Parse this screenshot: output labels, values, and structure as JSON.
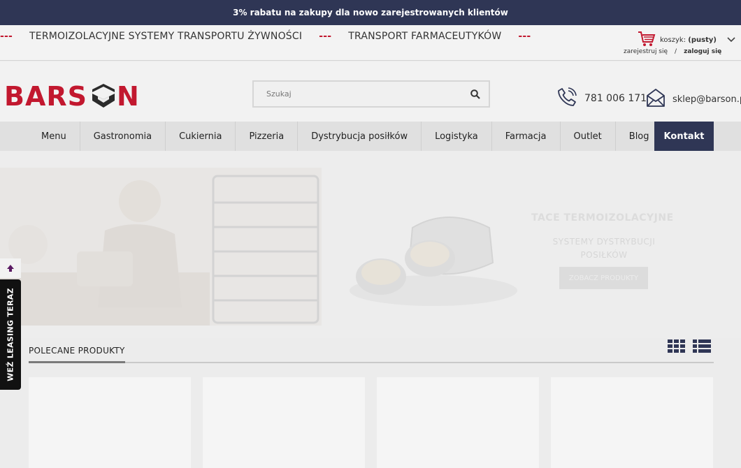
{
  "promo": {
    "text": "3% rabatu na zakupy dla nowo zarejestrowanych klientów"
  },
  "ticker": {
    "separator": "---",
    "items": [
      "TERMOIZOLACYJNE SYSTEMY TRANSPORTU ŻYWNOŚCI",
      "TRANSPORT FARMACEUTYKÓW"
    ]
  },
  "cart": {
    "label": "koszyk:",
    "status": "(pusty)",
    "register": "zarejestruj się",
    "slash": "/",
    "login": "zaloguj się"
  },
  "logo": {
    "text": "BARSON",
    "color": "#c2182f"
  },
  "search": {
    "placeholder": "Szukaj",
    "value": ""
  },
  "contact": {
    "phone": "781 006 171",
    "email": "sklep@barson.p"
  },
  "nav": {
    "items": [
      "Menu",
      "Gastronomia",
      "Cukiernia",
      "Pizzeria",
      "Dystrybucja posiłków",
      "Logistyka",
      "Farmacja",
      "Outlet",
      "Blog"
    ],
    "contact": "Kontakt"
  },
  "hero": {
    "title": "TACE TERMOIZOLACYJNE",
    "subtitle": "SYSTEMY DYSTRYBUCJI POSIŁKÓW",
    "button": "ZOBACZ PRODUKTY"
  },
  "section": {
    "title": "POLECANE PRODUKTY"
  },
  "side": {
    "leasing": "WEŹ LEASING TERAZ"
  },
  "colors": {
    "navy": "#2f3655",
    "brand_red": "#c2182f",
    "dark": "#111111"
  },
  "icons": [
    "cart-icon",
    "chevron-down-icon",
    "search-icon",
    "phone-icon",
    "mail-icon",
    "grid-view-icon",
    "list-view-icon",
    "arrow-up-icon"
  ]
}
